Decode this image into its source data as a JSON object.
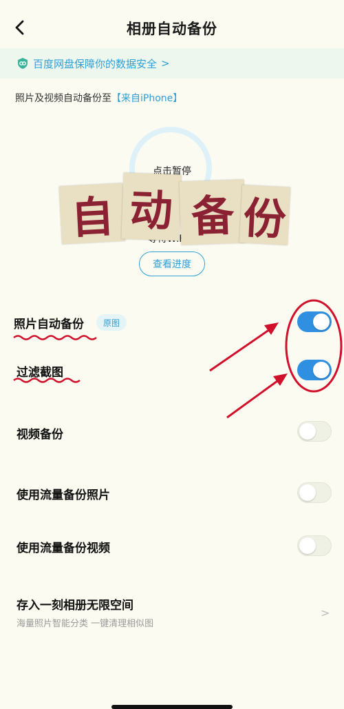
{
  "header": {
    "title": "相册自动备份",
    "back_icon": "back-arrow-icon"
  },
  "banner": {
    "text": "百度网盘保障你的数据安全",
    "icon": "shield-icon",
    "chevron": ">"
  },
  "destination": {
    "prefix": "照片及视频自动备份至",
    "target": "【来自iPhone】"
  },
  "status": {
    "pause_text": "点击暂停",
    "waiting_text": "等待WiFi中",
    "progress_button": "查看进度"
  },
  "overlay_title": {
    "chars": [
      "自",
      "动",
      "备",
      "份"
    ],
    "color": "#8a2233"
  },
  "settings": [
    {
      "label": "照片自动备份",
      "badge": "原图",
      "enabled": true
    },
    {
      "label": "过滤截图",
      "enabled": true
    },
    {
      "label": "视频备份",
      "enabled": false
    },
    {
      "label": "使用流量备份照片",
      "enabled": false
    },
    {
      "label": "使用流量备份视频",
      "enabled": false
    }
  ],
  "storage": {
    "title": "存入一刻相册无限空间",
    "subtitle": "海量照片智能分类 一键清理相似图",
    "chevron": ">"
  },
  "colors": {
    "accent": "#2f9fd6",
    "toggle_on": "#2f8fe0",
    "annotation": "#d0102a"
  }
}
